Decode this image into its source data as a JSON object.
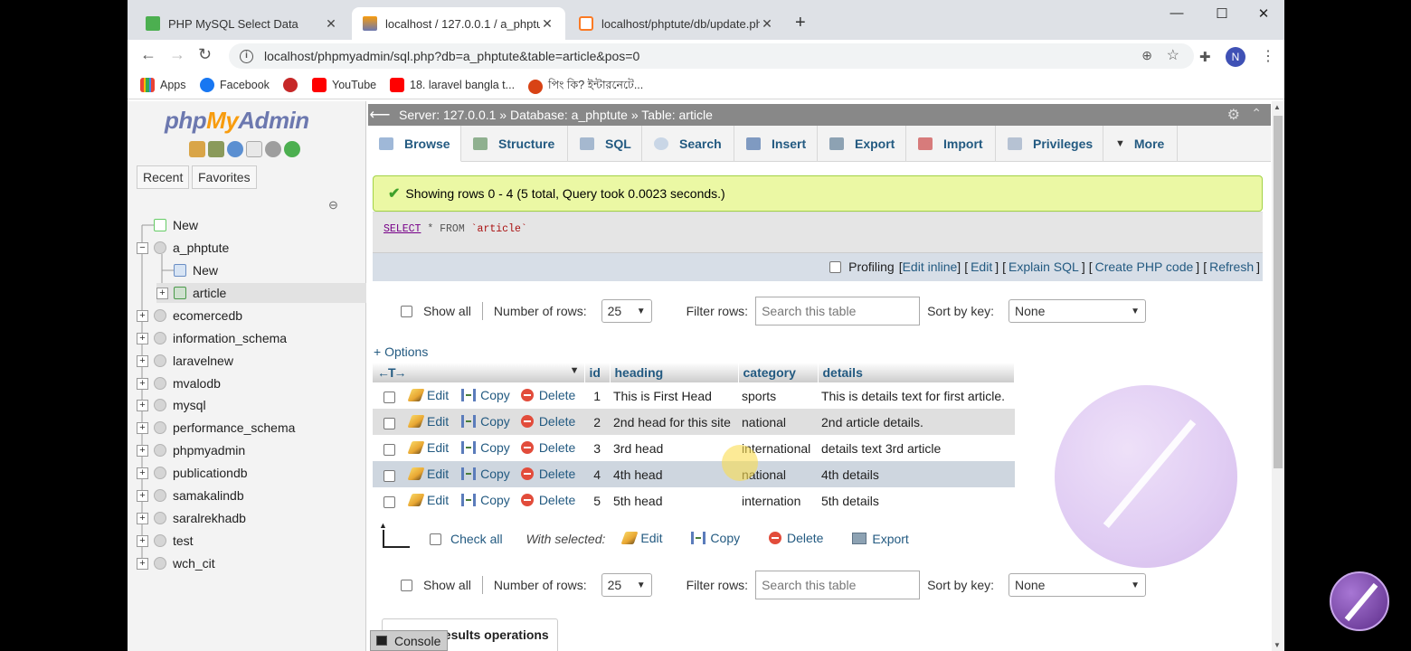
{
  "browser": {
    "tabs": [
      {
        "title": "PHP MySQL Select Data",
        "active": false
      },
      {
        "title": "localhost / 127.0.0.1 / a_phptute",
        "active": true
      },
      {
        "title": "localhost/phptute/db/update.php",
        "active": false
      }
    ],
    "new_tab": "+",
    "window_controls": {
      "minimize": "—",
      "maximize": "☐",
      "close": "✕"
    },
    "url": "localhost/phpmyadmin/sql.php?db=a_phptute&table=article&pos=0",
    "avatar_letter": "N",
    "bookmarks": [
      {
        "label": "Apps",
        "icon": "apps-grid-icon"
      },
      {
        "label": "Facebook",
        "icon": "facebook-icon"
      },
      {
        "label": "",
        "icon": "circle-logo-icon"
      },
      {
        "label": "YouTube",
        "icon": "youtube-icon"
      },
      {
        "label": "18. laravel bangla t...",
        "icon": "youtube-icon"
      },
      {
        "label": "পিং কি? ইন্টারনেটে...",
        "icon": "face-icon"
      }
    ]
  },
  "nav": {
    "logo_php": "php",
    "logo_my": "My",
    "logo_admin": "Admin",
    "tabs": [
      "Recent",
      "Favorites"
    ],
    "tree": [
      {
        "label": "New",
        "level": 0,
        "expander": ""
      },
      {
        "label": "a_phptute",
        "level": 0,
        "expander": "−"
      },
      {
        "label": "New",
        "level": 1,
        "expander": ""
      },
      {
        "label": "article",
        "level": 1,
        "expander": "+"
      },
      {
        "label": "ecomercedb",
        "level": 0,
        "expander": "+"
      },
      {
        "label": "information_schema",
        "level": 0,
        "expander": "+"
      },
      {
        "label": "laravelnew",
        "level": 0,
        "expander": "+"
      },
      {
        "label": "mvalodb",
        "level": 0,
        "expander": "+"
      },
      {
        "label": "mysql",
        "level": 0,
        "expander": "+"
      },
      {
        "label": "performance_schema",
        "level": 0,
        "expander": "+"
      },
      {
        "label": "phpmyadmin",
        "level": 0,
        "expander": "+"
      },
      {
        "label": "publicationdb",
        "level": 0,
        "expander": "+"
      },
      {
        "label": "samakalindb",
        "level": 0,
        "expander": "+"
      },
      {
        "label": "saralrekhadb",
        "level": 0,
        "expander": "+"
      },
      {
        "label": "test",
        "level": 0,
        "expander": "+"
      },
      {
        "label": "wch_cit",
        "level": 0,
        "expander": "+"
      }
    ]
  },
  "main": {
    "breadcrumb": "Server: 127.0.0.1 » Database: a_phptute » Table: article",
    "menu": [
      "Browse",
      "Structure",
      "SQL",
      "Search",
      "Insert",
      "Export",
      "Import",
      "Privileges",
      "More"
    ],
    "success_message": "Showing rows 0 - 4 (5 total, Query took 0.0023 seconds.)",
    "query": {
      "kw": "SELECT",
      "rest": "* FROM",
      "table": "`article`"
    },
    "profiling": {
      "label": "Profiling",
      "links": [
        "Edit inline",
        "Edit",
        "Explain SQL",
        "Create PHP code",
        "Refresh"
      ]
    },
    "show_all": "Show all",
    "number_of_rows_label": "Number of rows:",
    "number_of_rows_value": "25",
    "filter_rows_label": "Filter rows:",
    "filter_placeholder": "Search this table",
    "sort_by_key_label": "Sort by key:",
    "sort_by_key_value": "None",
    "options_link": "+ Options",
    "columns": [
      "id",
      "heading",
      "category",
      "details"
    ],
    "row_actions": {
      "edit": "Edit",
      "copy": "Copy",
      "delete": "Delete"
    },
    "rows": [
      {
        "id": "1",
        "heading": "This is First Head",
        "category": "sports",
        "details": "This is details text for first article."
      },
      {
        "id": "2",
        "heading": "2nd head for this site",
        "category": "national",
        "details": "2nd article details."
      },
      {
        "id": "3",
        "heading": "3rd head",
        "category": "international",
        "details": "details text 3rd article"
      },
      {
        "id": "4",
        "heading": "4th head",
        "category": "national",
        "details": "4th details"
      },
      {
        "id": "5",
        "heading": "5th head",
        "category": "internation",
        "details": "5th details"
      }
    ],
    "check_all": "Check all",
    "with_selected": "With selected:",
    "bulk_actions": [
      "Edit",
      "Copy",
      "Delete",
      "Export"
    ],
    "query_results_operations": "Query results operations",
    "console": "Console"
  }
}
